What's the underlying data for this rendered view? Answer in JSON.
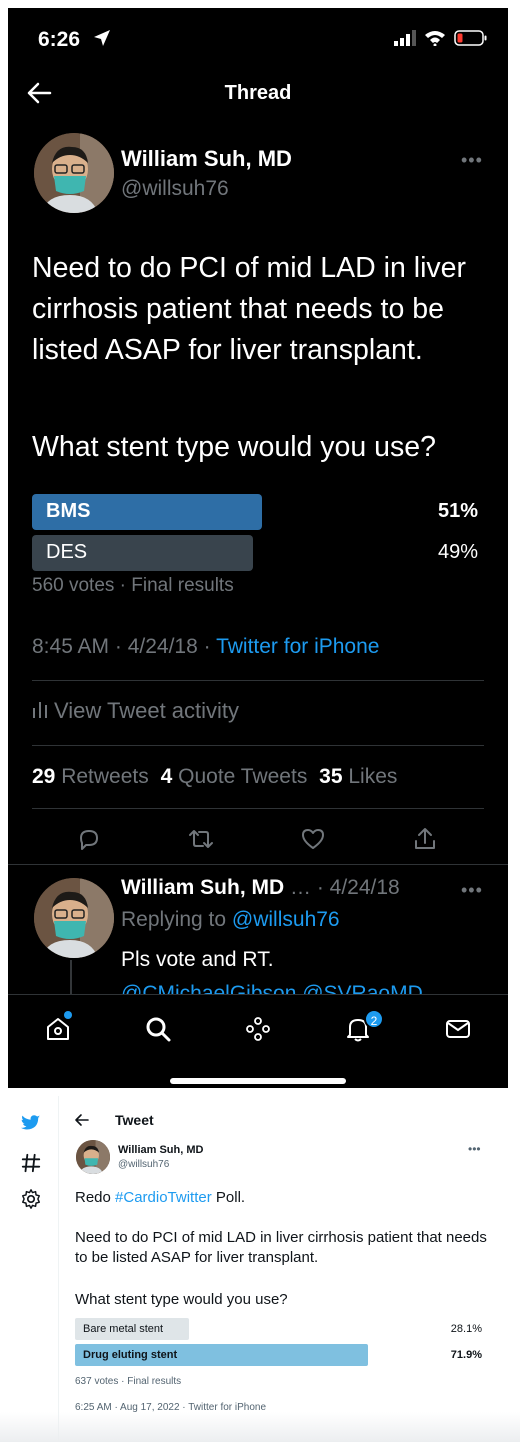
{
  "status_bar": {
    "time": "6:26"
  },
  "nav": {
    "title": "Thread"
  },
  "tweet": {
    "author_name": "William Suh, MD",
    "author_handle": "@willsuh76",
    "text": "Need to do PCI of mid LAD in liver cirrhosis patient that needs to be listed ASAP for liver transplant.",
    "question": "What stent type would you use?",
    "poll": {
      "options": [
        {
          "label": "BMS",
          "percent_text": "51%",
          "value": 51,
          "winner": true
        },
        {
          "label": "DES",
          "percent_text": "49%",
          "value": 49,
          "winner": false
        }
      ],
      "meta": "560 votes · Final results"
    },
    "time": "8:45 AM · 4/24/18 · ",
    "source": "Twitter for iPhone",
    "view_activity": "View Tweet activity",
    "stats": {
      "retweets_count": "29",
      "retweets_label": "Retweets",
      "quotes_count": "4",
      "quotes_label": "Quote Tweets",
      "likes_count": "35",
      "likes_label": "Likes"
    },
    "actions": [
      "reply-icon",
      "retweet-icon",
      "like-icon",
      "share-icon"
    ]
  },
  "reply": {
    "author_name": "William Suh, MD",
    "date": " … · 4/24/18",
    "replying_prefix": "Replying to ",
    "replying_handle": "@willsuh76",
    "text": "Pls vote and RT.",
    "mention_partial": "@CMichaelGibson @SVRaoMD"
  },
  "tab_bar": {
    "icons": [
      "home-icon",
      "search-icon",
      "spaces-icon",
      "notifications-icon",
      "messages-icon"
    ],
    "notification_badge": "2"
  },
  "web_tweet": {
    "header_title": "Tweet",
    "author_name": "William Suh, MD",
    "author_handle": "@willsuh76",
    "line1_prefix": "Redo ",
    "hashtag": "#CardioTwitter",
    "line1_suffix": " Poll.",
    "text": "Need to do PCI of mid LAD in liver cirrhosis patient that needs to be listed ASAP for liver transplant.",
    "question": "What stent type would you use?",
    "poll": {
      "options": [
        {
          "label": "Bare metal stent",
          "percent_text": "28.1%",
          "value": 28.1,
          "winner": false
        },
        {
          "label": "Drug eluting stent",
          "percent_text": "71.9%",
          "value": 71.9,
          "winner": true
        }
      ],
      "meta": "637 votes · Final results"
    },
    "timestamp": "6:25 AM · Aug 17, 2022 · Twitter for iPhone",
    "sidebar_icons": [
      "twitter-logo-icon",
      "hashtag-icon",
      "settings-icon"
    ]
  },
  "colors": {
    "accent": "#1d9bf0",
    "poll_winner_dark": "#2e6ea6",
    "poll_loser_dark": "#39444d",
    "poll_winner_light": "#7fc0e0",
    "poll_loser_light": "#dfe5e8"
  }
}
